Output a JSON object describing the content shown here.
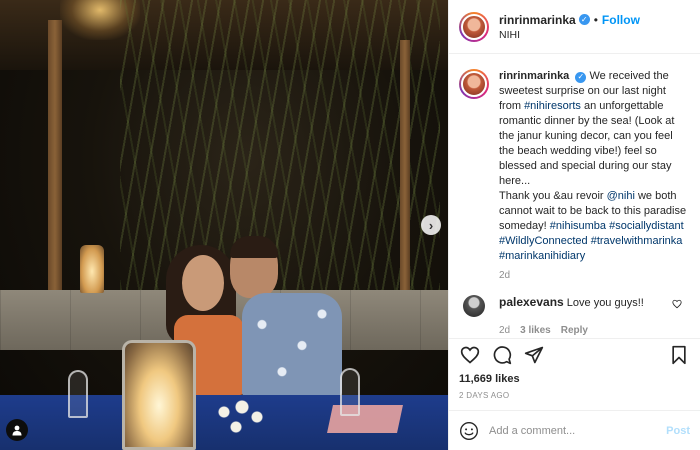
{
  "header": {
    "username": "rinrinmarinka",
    "separator": "•",
    "follow_label": "Follow",
    "location": "NIHI"
  },
  "photo": {
    "carousel_next_glyph": "›"
  },
  "caption": {
    "username": "rinrinmarinka",
    "text_1": "We received the sweetest surprise on our last night from",
    "tag_1": "#nihiresorts",
    "text_2": "an unforgettable romantic dinner by the sea! (Look at the janur kuning decor, can you feel the beach wedding vibe!) feel so blessed and special during our stay here...",
    "text_3": "Thank you &au revoir",
    "tag_2": "@nihi",
    "text_4": "we both cannot wait to be back to this paradise someday!",
    "tags": [
      "#nihisumba",
      "#sociallydistant",
      "#WildlyConnected",
      "#travelwithmarinka",
      "#marinkanihidiary"
    ],
    "time": "2d"
  },
  "comments": [
    {
      "username": "palexevans",
      "text": "Love you guys!!",
      "time": "2d",
      "likes": "3 likes",
      "reply_label": "Reply"
    }
  ],
  "stats": {
    "likes": "11,669 likes",
    "date": "2 DAYS AGO"
  },
  "add_comment": {
    "placeholder": "Add a comment...",
    "post_label": "Post"
  },
  "icons": {
    "like": "heart-icon",
    "comment": "comment-icon",
    "share": "paper-plane-icon",
    "save": "bookmark-icon",
    "emoji": "smiley-icon"
  },
  "colors": {
    "accent": "#0095f6",
    "verified": "#3897f0",
    "hashtag": "#00376b",
    "muted": "#8e8e8e",
    "post_disabled": "#b2dffc"
  }
}
